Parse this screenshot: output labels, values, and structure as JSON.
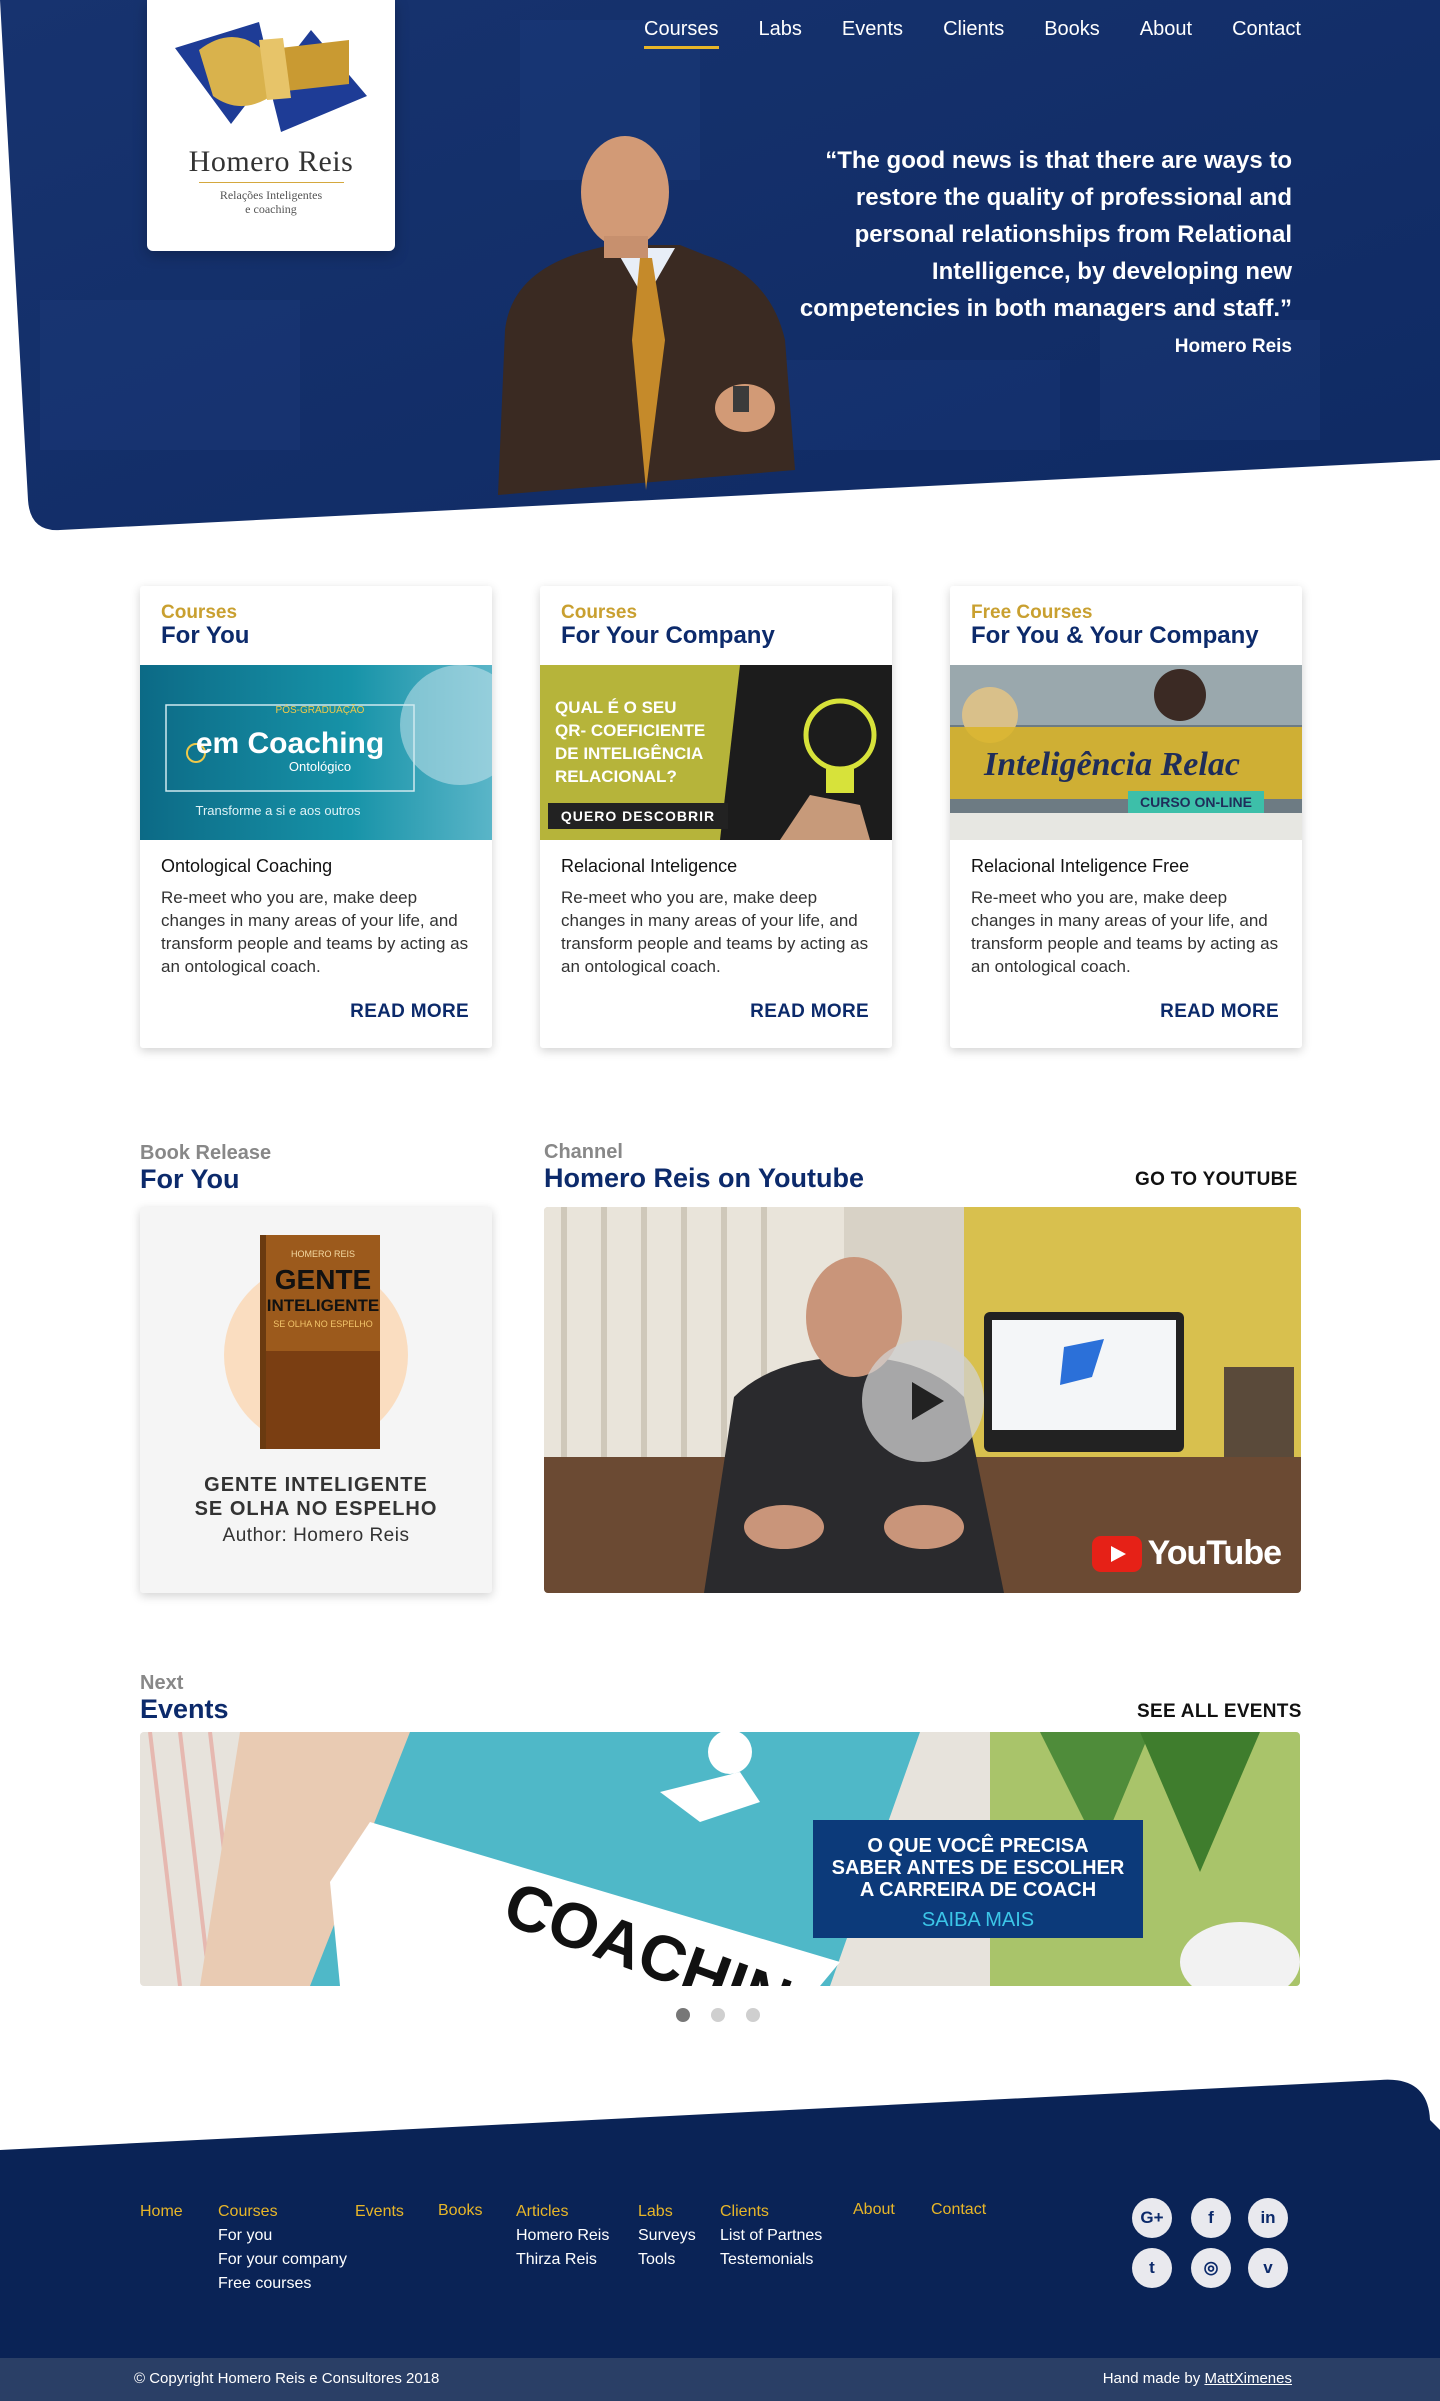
{
  "brand": {
    "name": "Homero Reis",
    "tagline_line1": "Relações Inteligentes",
    "tagline_line2": "e coaching"
  },
  "nav": {
    "items": [
      {
        "label": "Courses",
        "active": true
      },
      {
        "label": "Labs"
      },
      {
        "label": "Events"
      },
      {
        "label": "Clients"
      },
      {
        "label": "Books"
      },
      {
        "label": "About"
      },
      {
        "label": "Contact"
      }
    ]
  },
  "hero": {
    "quote": "“The good news is that there are ways to restore the quality of professional and personal relationships from Relational Intelligence, by developing new competencies in both managers and staff.”",
    "author": "Homero Reis"
  },
  "courses": [
    {
      "eyebrow": "Courses",
      "title": "For You",
      "image": {
        "tag": "PÓS-GRADUAÇÃO",
        "headline": "em Coaching",
        "sub": "Ontológico",
        "caption": "Transforme a si e aos outros"
      },
      "name": "Ontological Coaching",
      "description": "Re-meet who you are, make deep changes in many areas of your life, and transform people and teams by acting as an ontological coach.",
      "cta": "READ MORE"
    },
    {
      "eyebrow": "Courses",
      "title": "For Your Company",
      "image": {
        "line1": "QUAL É O SEU",
        "line2": "QR- COEFICIENTE",
        "line3": "DE INTELIGÊNCIA",
        "line4": "RELACIONAL?",
        "button": "QUERO DESCOBRIR"
      },
      "name": "Relacional Inteligence",
      "description": "Re-meet who you are, make deep changes in many areas of your life, and transform people and teams by acting as an ontological coach.",
      "cta": "READ MORE"
    },
    {
      "eyebrow": "Free Courses",
      "title": "For You & Your Company",
      "image": {
        "script": "Inteligência Relac",
        "badge": "CURSO ON-LINE"
      },
      "name": "Relacional Inteligence Free",
      "description": "Re-meet who you are, make deep changes in many areas of your life, and transform people and teams by acting as an ontological coach.",
      "cta": "READ MORE"
    }
  ],
  "book": {
    "eyebrow": "Book Release",
    "title": "For You",
    "cover": {
      "author": "HOMERO REIS",
      "title1": "GENTE",
      "title2": "INTELIGENTE",
      "title3": "SE OLHA NO ESPELHO"
    },
    "name_line1": "GENTE INTELIGENTE",
    "name_line2": "SE OLHA NO ESPELHO",
    "author": "Author: Homero Reis"
  },
  "channel": {
    "eyebrow": "Channel",
    "title": "Homero Reis on Youtube",
    "link": "GO TO YOUTUBE",
    "logo_word": "YouTube"
  },
  "events": {
    "eyebrow": "Next",
    "title": "Events",
    "link": "SEE ALL EVENTS",
    "banner_word": "COACHING",
    "headline_line1": "O QUE VOCÊ PRECISA",
    "headline_line2": "SABER ANTES DE ESCOLHER",
    "headline_line3": "A CARREIRA DE COACH",
    "cta": "SAIBA MAIS",
    "slides": 3,
    "active_slide": 1
  },
  "footer": {
    "columns": [
      {
        "head": "Home",
        "items": []
      },
      {
        "head": "Courses",
        "items": [
          "For you",
          "For your company",
          "Free courses"
        ]
      },
      {
        "head": "Events",
        "items": []
      },
      {
        "head": "Books",
        "items": []
      },
      {
        "head": "Articles",
        "items": [
          "Homero Reis",
          "Thirza Reis"
        ]
      },
      {
        "head": "Labs",
        "items": [
          "Surveys",
          "Tools"
        ]
      },
      {
        "head": "Clients",
        "items": [
          "List of Partnes",
          "Testemonials"
        ]
      },
      {
        "head": "About",
        "items": []
      },
      {
        "head": "Contact",
        "items": []
      }
    ],
    "social": [
      {
        "icon": "google-plus-icon",
        "glyph": "G+"
      },
      {
        "icon": "facebook-icon",
        "glyph": "f"
      },
      {
        "icon": "linkedin-icon",
        "glyph": "in"
      },
      {
        "icon": "twitter-icon",
        "glyph": "t"
      },
      {
        "icon": "instagram-icon",
        "glyph": "◎"
      },
      {
        "icon": "vimeo-icon",
        "glyph": "v"
      }
    ],
    "copyright": "© Copyright Homero Reis e Consultores 2018",
    "credit_prefix": "Hand made by",
    "credit_name": "MattXimenes"
  },
  "colors": {
    "navy": "#0c2a6b",
    "gold": "#e8b628",
    "footer_bar": "#2a3f66"
  }
}
